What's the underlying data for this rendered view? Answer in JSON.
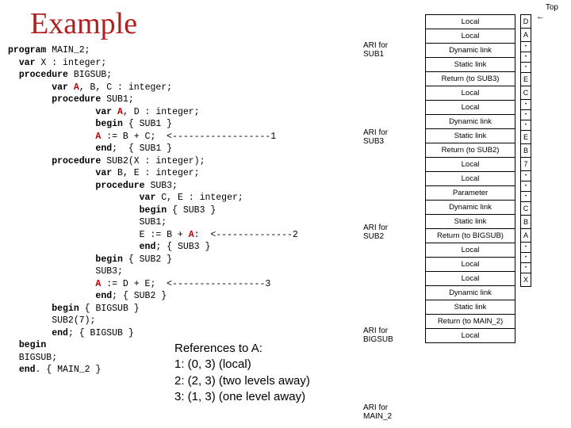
{
  "title": "Example",
  "code": "program MAIN_2;\n  var X : integer;\n  procedure BIGSUB;\n        var A, B, C : integer;\n        procedure SUB1;\n                var A, D : integer;\n                begin { SUB1 }\n                A := B + C;  <------------------1\n                end;  { SUB1 }\n        procedure SUB2(X : integer);\n                var B, E : integer;\n                procedure SUB3;\n                        var C, E : integer;\n                        begin { SUB3 }\n                        SUB1;\n                        E := B + A:  <--------------2\n                        end; { SUB3 }\n                begin { SUB2 }\n                SUB3;\n                A := D + E;  <-----------------3\n                end; { SUB2 }\n        begin { BIGSUB }\n        SUB2(7);\n        end; { BIGSUB }\n  begin\n  BIGSUB;\n  end. { MAIN_2 }",
  "references": {
    "heading": "References to A:",
    "line1": "1: (0, 3) (local)",
    "line2": "2: (2, 3) (two levels away)",
    "line3": "3: (1, 3) (one level away)"
  },
  "diagram": {
    "top": "Top",
    "ari_sub1": "ARI for\nSUB1",
    "ari_sub3": "ARI for\nSUB3",
    "ari_sub2": "ARI for\nSUB2",
    "ari_bigsub": "ARI for\nBIGSUB",
    "ari_main2": "ARI for\nMAIN_2",
    "cells": [
      "Local",
      "Local",
      "Dynamic link",
      "Static link",
      "Return (to SUB3)",
      "Local",
      "Local",
      "Dynamic link",
      "Static link",
      "Return (to SUB2)",
      "Local",
      "Local",
      "Parameter",
      "Dynamic link",
      "Static link",
      "Return (to BIGSUB)",
      "Local",
      "Local",
      "Local",
      "Dynamic link",
      "Static link",
      "Return (to MAIN_2)",
      "Local"
    ],
    "right": [
      "D",
      "A",
      "",
      "",
      "",
      "E",
      "C",
      "",
      "",
      "",
      "E",
      "B",
      "7",
      "",
      "",
      "",
      "C",
      "B",
      "A",
      "",
      "",
      "",
      "X"
    ]
  }
}
